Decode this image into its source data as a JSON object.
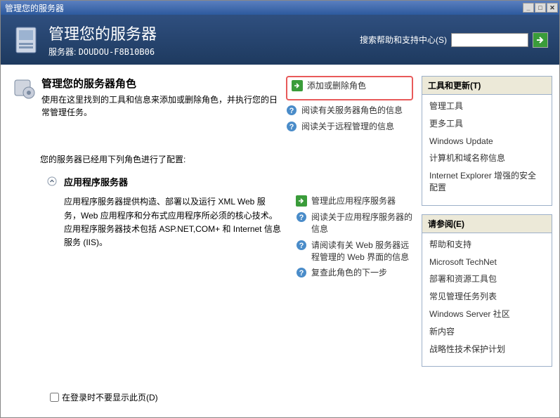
{
  "window": {
    "title": "管理您的服务器"
  },
  "header": {
    "title": "管理您的服务器",
    "server_label": "服务器:",
    "server_name": "DOUDOU-F8B10B06",
    "search_label": "搜索帮助和支持中心(S)"
  },
  "roles": {
    "title": "管理您的服务器角色",
    "desc": "使用在这里找到的工具和信息来添加或删除角色，并执行您的日常管理任务。",
    "actions": {
      "add_remove": "添加或删除角色",
      "read_roles": "阅读有关服务器角色的信息",
      "read_remote": "阅读关于远程管理的信息"
    }
  },
  "configured_intro": "您的服务器已经用下列角色进行了配置:",
  "app_server": {
    "title": "应用程序服务器",
    "desc": "应用程序服务器提供构造、部署以及运行 XML Web 服务，Web 应用程序和分布式应用程序所必须的核心技术。应用程序服务器技术包括 ASP.NET,COM+ 和 Internet 信息服务 (IIS)。",
    "actions": {
      "manage": "管理此应用程序服务器",
      "read_info": "阅读关于应用程序服务器的信息",
      "read_web": "请阅读有关 Web 服务器远程管理的 Web 界面的信息",
      "review_next": "复查此角色的下一步"
    }
  },
  "panel_tools": {
    "title": "工具和更新(T)",
    "links": {
      "manage_tools": "管理工具",
      "more_tools": "更多工具",
      "windows_update": "Windows Update",
      "computer_domain": "计算机和域名称信息",
      "ie_security": "Internet Explorer 增强的安全配置"
    }
  },
  "panel_ref": {
    "title": "请参阅(E)",
    "links": {
      "help": "帮助和支持",
      "technet": "Microsoft TechNet",
      "deploy": "部署和资源工具包",
      "tasks": "常见管理任务列表",
      "community": "Windows Server 社区",
      "whatsnew": "新内容",
      "strategy": "战略性技术保护计划"
    }
  },
  "footer": {
    "checkbox_label": "在登录时不要显示此页(D)"
  }
}
